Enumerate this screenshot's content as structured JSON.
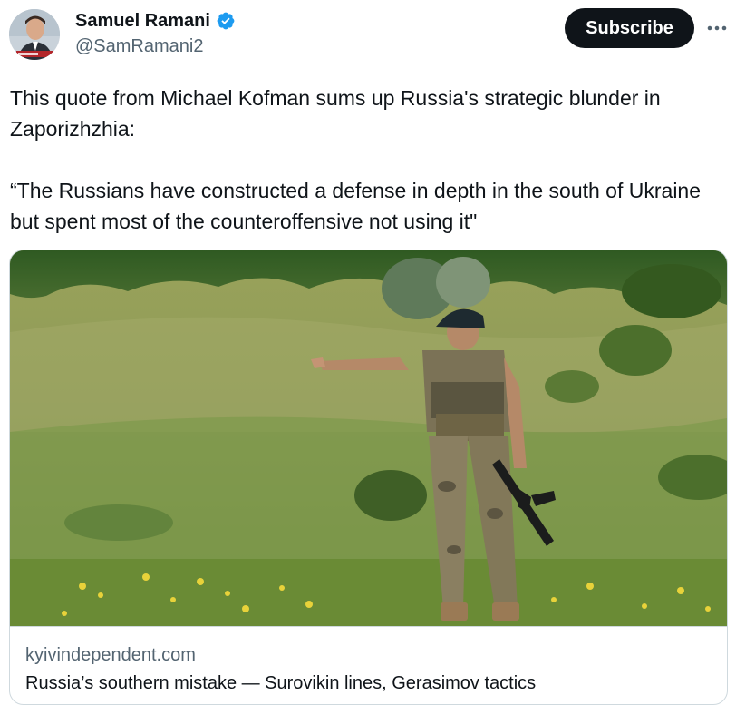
{
  "author": {
    "display_name": "Samuel Ramani",
    "handle": "@SamRamani2",
    "verified_icon": "verified-badge-icon"
  },
  "actions": {
    "subscribe_label": "Subscribe",
    "more_icon": "more-options-icon"
  },
  "tweet": {
    "text": "This quote from Michael Kofman sums up Russia's strategic blunder in Zaporizhzhia:\n\n“The Russians have constructed a defense in depth in the south of Ukraine but spent most of the counteroffensive not using it\""
  },
  "link_card": {
    "domain": "kyivindependent.com",
    "title": "Russia’s southern mistake — Surovikin lines, Gerasimov tactics"
  },
  "colors": {
    "text_primary": "#0f1419",
    "text_secondary": "#536471",
    "verified_blue": "#1d9bf0",
    "border": "#cfd9de",
    "button_bg": "#0f1419"
  }
}
